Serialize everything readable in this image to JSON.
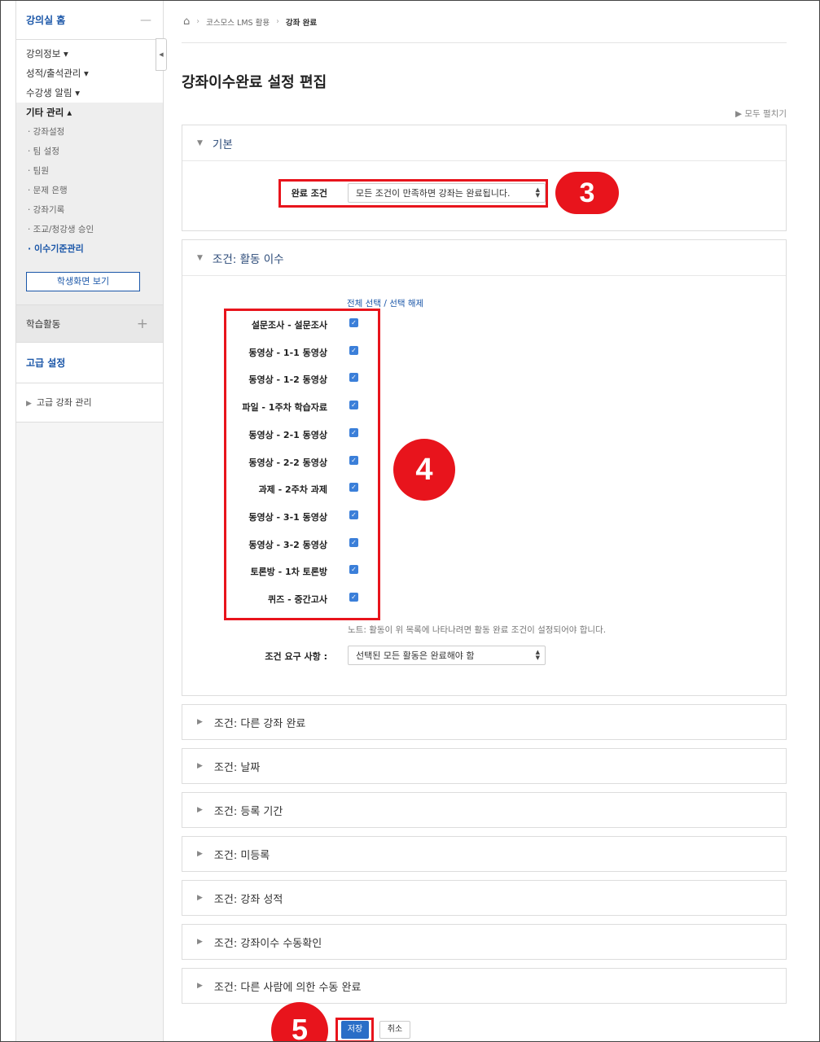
{
  "sidebar": {
    "home": "강의실 홈",
    "collapse": "—",
    "menu": [
      "강의정보 ▾",
      "성적/출석관리 ▾",
      "수강생 알림 ▾"
    ],
    "other_mgmt": "기타 관리 ▴",
    "sub": [
      "· 강좌설정",
      "· 팀 설정",
      "· 팀원",
      "· 문제 은행",
      "· 강좌기록",
      "· 조교/청강생 승인"
    ],
    "sub_active": "· 이수기준관리",
    "student_view": "학생화면 보기",
    "learning": "학습활동",
    "learning_plus": "+",
    "advanced": "고급 설정",
    "advanced_mgmt": "고급 강좌 관리"
  },
  "breadcrumb": {
    "items": [
      "코스모스 LMS 활용",
      "강좌 완료"
    ]
  },
  "page_title": "강좌이수완료 설정 편집",
  "expand_all": "▶ 모두 펼치기",
  "general": {
    "header": "기본",
    "completion_label": "완료 조건",
    "completion_value": "모든 조건이 만족하면 강좌는 완료됩니다."
  },
  "activity": {
    "header": "조건: 활동 이수",
    "select_all": "전체 선택 / 선택 해제",
    "items": [
      "설문조사 - 설문조사",
      "동영상 - 1-1 동영상",
      "동영상 - 1-2 동영상",
      "파일 - 1주차 학습자료",
      "동영상 - 2-1 동영상",
      "동영상 - 2-2 동영상",
      "과제 - 2주차 과제",
      "동영상 - 3-1 동영상",
      "동영상 - 3-2 동영상",
      "토론방 - 1차 토론방",
      "퀴즈 - 중간고사"
    ],
    "checked": [
      true,
      true,
      true,
      true,
      true,
      true,
      true,
      true,
      true,
      true,
      true
    ],
    "note": "노트: 활동이 위 목록에 나타나려면 활동 완료 조건이 설정되어야 합니다.",
    "req_label": "조건 요구 사항 :",
    "req_value": "선택된 모든 활동은 완료해야 함"
  },
  "collapsed_sections": [
    "조건: 다른 강좌 완료",
    "조건: 날짜",
    "조건: 등록 기간",
    "조건: 미등록",
    "조건: 강좌 성적",
    "조건: 강좌이수 수동확인",
    "조건: 다른 사람에 의한 수동 완료"
  ],
  "buttons": {
    "save": "저장",
    "cancel": "취소"
  },
  "badges": {
    "b3": "3",
    "b4": "4",
    "b5": "5"
  },
  "colors": {
    "accent": "#1a56a8",
    "highlight": "#e8141c",
    "save_button": "#2a6ec7",
    "checkbox": "#3b7fd9"
  }
}
